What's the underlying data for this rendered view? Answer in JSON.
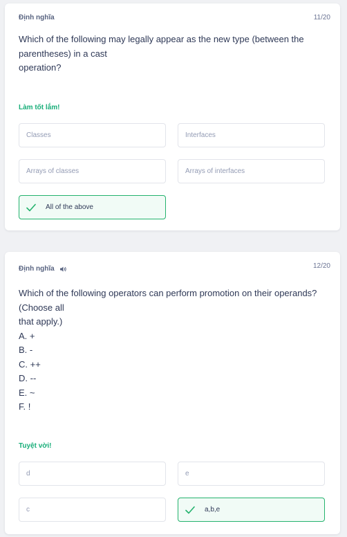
{
  "colors": {
    "accent_green": "#23b26d",
    "text_dark": "#2e3856",
    "muted": "#939bb4",
    "background": "#f0f1f4"
  },
  "cards": [
    {
      "label": "Định nghĩa",
      "counter": "11/20",
      "question_lines": [
        "Which of the following may legally appear as the new type (between the",
        "parentheses) in a cast",
        "operation?"
      ],
      "feedback": "Làm tốt lắm!",
      "options": [
        "Classes",
        "Interfaces",
        "Arrays of classes",
        "Arrays of interfaces",
        "All of the above"
      ],
      "correct_option_index": 4
    },
    {
      "label": "Định nghĩa",
      "speaker_icon": "speaker-icon",
      "counter": "12/20",
      "question_lines": [
        "Which of the following operators can perform promotion on their operands?",
        "(Choose all",
        "that apply.)",
        "A. +",
        "B. -",
        "C. ++",
        "D. --",
        "E. ~",
        "F. !"
      ],
      "feedback": "Tuyệt vời!",
      "options": [
        "d",
        "e",
        "c",
        "a,b,e"
      ],
      "correct_option_index": 3
    }
  ]
}
